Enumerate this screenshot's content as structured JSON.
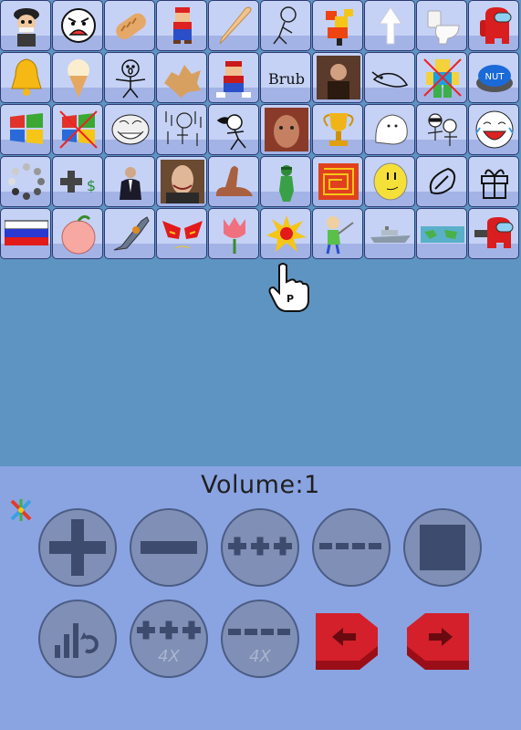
{
  "grid": {
    "rows": [
      [
        "mascot-face-icon",
        "angry-face-icon",
        "bread-icon",
        "mario-icon",
        "bat-icon",
        "stick-figure-icon",
        "pixel-bird-icon",
        "up-arrow-icon",
        "toilet-icon",
        "among-us-red-icon"
      ],
      [
        "bell-icon",
        "ice-cream-icon",
        "scared-stickman-icon",
        "explosion-icon",
        "mario-icon",
        "brub-text-icon",
        "portrait-man-icon",
        "goose-icon",
        "roblox-noob-icon",
        "nut-button-icon"
      ],
      [
        "windows-logo-icon",
        "windows-crossed-icon",
        "troll-face-icon",
        "rain-stickman-icon",
        "running-stickman-icon",
        "photo-face-icon",
        "trophy-icon",
        "ghost-face-icon",
        "sunglasses-stickmen-icon",
        "laughing-face-icon"
      ],
      [
        "loading-spinner-icon",
        "plus-dollar-icon",
        "suited-man-icon",
        "photo-man-icon",
        "dinosaur-icon",
        "green-figure-icon",
        "red-maze-icon",
        "yellow-face-icon",
        "leaf-outline-icon",
        "gift-box-icon"
      ],
      [
        "russia-flag-icon",
        "peach-icon",
        "ray-gun-icon",
        "red-eyes-icon",
        "tulip-icon",
        "explosion-burst-icon",
        "baldi-icon",
        "ship-icon",
        "map-icon",
        "among-us-gun-icon"
      ]
    ],
    "brub_text": "Brub",
    "nut_text": "NUT"
  },
  "cursor": {
    "icon": "pointing-hand-cursor-icon",
    "letter": "P"
  },
  "volume": {
    "label": "Volume:",
    "value": "1"
  },
  "controls": {
    "row1": [
      "plus-button",
      "minus-button",
      "plus-plus-plus-button",
      "minus-minus-minus-minus-button",
      "stop-button"
    ],
    "row2": [
      "replay-volume-button",
      "plus-plus-plus-4x-button",
      "minus-minus-minus-minus-4x-button",
      "arrow-left-button",
      "arrow-right-button"
    ],
    "multiplier_label": "4X"
  },
  "colors": {
    "tile_bg": "#c5d2f5",
    "tile_band": "#a3b3e6",
    "grid_bg": "#5e94c2",
    "panel_bg": "#8aa4e2",
    "control_btn": "#7f8fb5",
    "control_glyph": "#3d4b6e",
    "arrow_red": "#d3202b"
  }
}
